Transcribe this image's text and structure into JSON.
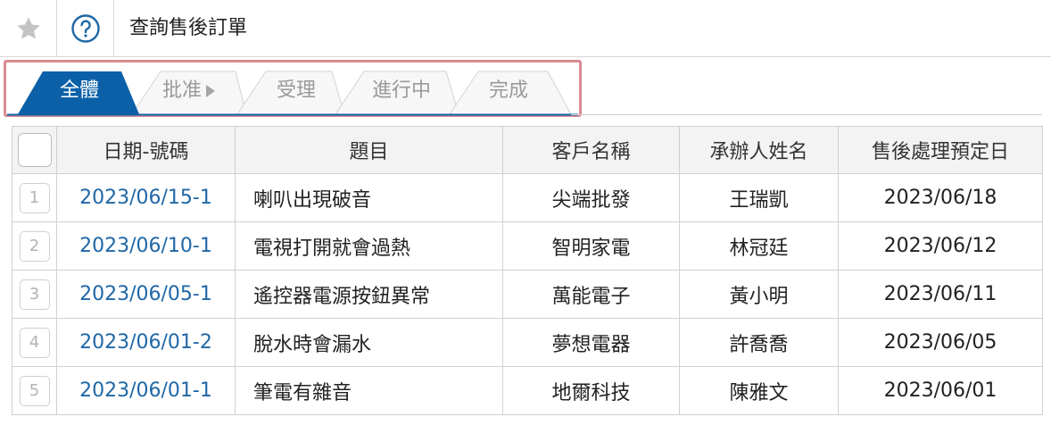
{
  "page": {
    "title": "查詢售後訂單"
  },
  "colors": {
    "accent": "#0b60a8",
    "link": "#1f67a6",
    "frame": "#d98b93"
  },
  "icons": {
    "favorite": "star-icon",
    "help": "help-circle-icon"
  },
  "tabs": [
    {
      "label": "全體",
      "active": true
    },
    {
      "label": "批准",
      "active": false,
      "has_arrow": true
    },
    {
      "label": "受理",
      "active": false
    },
    {
      "label": "進行中",
      "active": false
    },
    {
      "label": "完成",
      "active": false
    }
  ],
  "table": {
    "headers": [
      "日期-號碼",
      "題目",
      "客戶名稱",
      "承辦人姓名",
      "售後處理預定日"
    ],
    "rows": [
      {
        "num": "1",
        "id": "2023/06/15-1",
        "subject": "喇叭出現破音",
        "customer": "尖端批發",
        "handler": "王瑞凱",
        "due": "2023/06/18"
      },
      {
        "num": "2",
        "id": "2023/06/10-1",
        "subject": "電視打開就會過熱",
        "customer": "智明家電",
        "handler": "林冠廷",
        "due": "2023/06/12"
      },
      {
        "num": "3",
        "id": "2023/06/05-1",
        "subject": "遙控器電源按鈕異常",
        "customer": "萬能電子",
        "handler": "黃小明",
        "due": "2023/06/11"
      },
      {
        "num": "4",
        "id": "2023/06/01-2",
        "subject": "脫水時會漏水",
        "customer": "夢想電器",
        "handler": "許喬喬",
        "due": "2023/06/05"
      },
      {
        "num": "5",
        "id": "2023/06/01-1",
        "subject": "筆電有雜音",
        "customer": "地爾科技",
        "handler": "陳雅文",
        "due": "2023/06/01"
      }
    ]
  }
}
